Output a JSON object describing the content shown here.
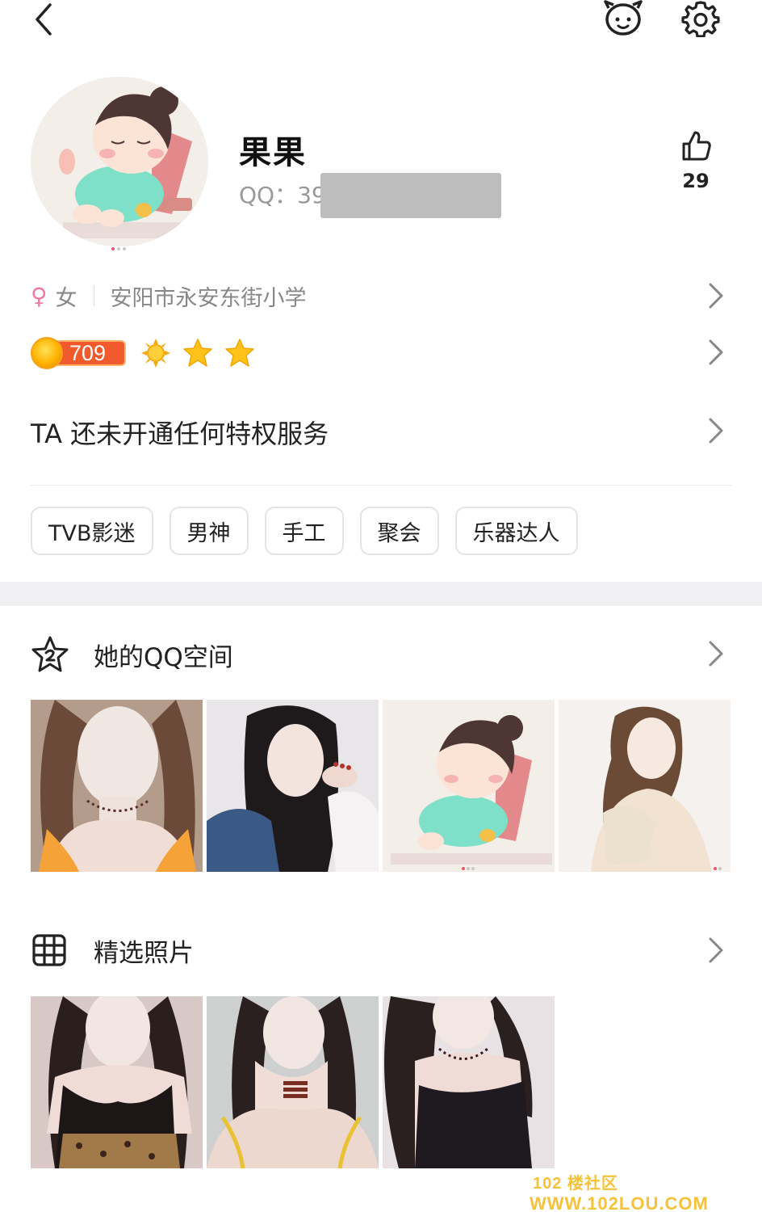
{
  "topbar": {
    "back_icon": "back-arrow-icon",
    "pet_icon": "pet-face-icon",
    "settings_icon": "gear-icon"
  },
  "profile": {
    "nickname": "果果",
    "qq_label": "QQ：39",
    "likes": "29",
    "gender": "女",
    "school": "安阳市永安东街小学",
    "level_value": "709",
    "privilege_text": "TA 还未开通任何特权服务"
  },
  "tags": [
    "TVB影迷",
    "男神",
    "手工",
    "聚会",
    "乐器达人"
  ],
  "qzone": {
    "title": "她的QQ空间",
    "icon": "star-2-icon"
  },
  "featured": {
    "title": "精选照片",
    "icon": "grid-icon"
  },
  "watermark": {
    "line1": "102 楼社区",
    "line2": "WWW.102LOU.COM"
  },
  "colors": {
    "accent_pink": "#e8566e",
    "level_orange": "#f05a2c",
    "star_yellow": "#ffc21a",
    "watermark": "#f6c23a"
  }
}
